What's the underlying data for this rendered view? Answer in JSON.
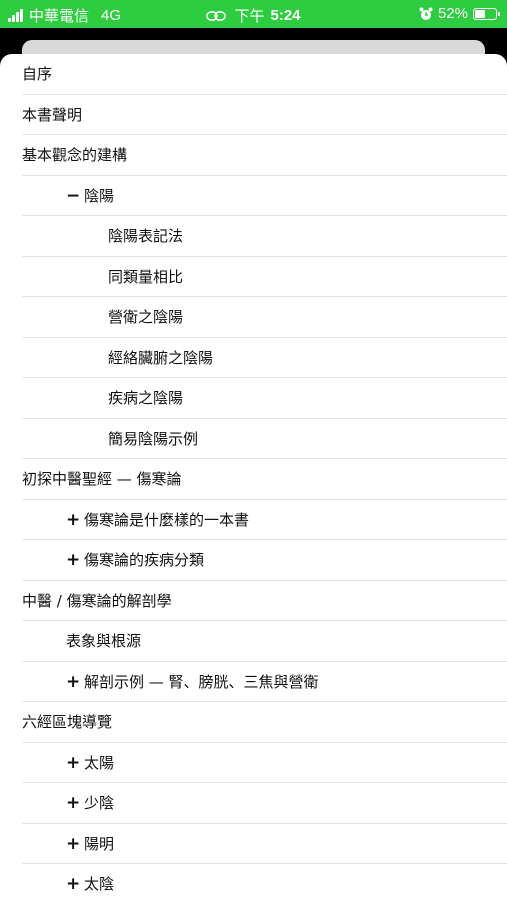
{
  "status_bar": {
    "carrier": "中華電信",
    "network": "4G",
    "time_prefix": "下午",
    "time": "5:24",
    "battery_percent": "52%",
    "battery_level": 0.52,
    "icons": [
      "signal-icon",
      "link-icon",
      "alarm-icon",
      "battery-charging-icon"
    ],
    "background_color": "#2ecc40"
  },
  "toc": {
    "items": [
      {
        "label": "自序",
        "level": 0,
        "marker": ""
      },
      {
        "label": "本書聲明",
        "level": 0,
        "marker": ""
      },
      {
        "label": "基本觀念的建構",
        "level": 0,
        "marker": ""
      },
      {
        "label": "陰陽",
        "level": 1,
        "marker": "−"
      },
      {
        "label": "陰陽表記法",
        "level": 2,
        "marker": ""
      },
      {
        "label": "同類量相比",
        "level": 2,
        "marker": ""
      },
      {
        "label": "營衛之陰陽",
        "level": 2,
        "marker": ""
      },
      {
        "label": "經絡臟腑之陰陽",
        "level": 2,
        "marker": ""
      },
      {
        "label": "疾病之陰陽",
        "level": 2,
        "marker": ""
      },
      {
        "label": "簡易陰陽示例",
        "level": 2,
        "marker": ""
      },
      {
        "label": "初探中醫聖經 — 傷寒論",
        "level": 0,
        "marker": ""
      },
      {
        "label": "傷寒論是什麼樣的一本書",
        "level": 1,
        "marker": "+"
      },
      {
        "label": "傷寒論的疾病分類",
        "level": 1,
        "marker": "+"
      },
      {
        "label": "中醫 / 傷寒論的解剖學",
        "level": 0,
        "marker": ""
      },
      {
        "label": "表象與根源",
        "level": 1,
        "marker": ""
      },
      {
        "label": "解剖示例 — 腎、膀胱、三焦與營衛",
        "level": 1,
        "marker": "+"
      },
      {
        "label": "六經區塊導覽",
        "level": 0,
        "marker": ""
      },
      {
        "label": "太陽",
        "level": 1,
        "marker": "+"
      },
      {
        "label": "少陰",
        "level": 1,
        "marker": "+"
      },
      {
        "label": "陽明",
        "level": 1,
        "marker": "+"
      },
      {
        "label": "太陰",
        "level": 1,
        "marker": "+"
      }
    ]
  }
}
